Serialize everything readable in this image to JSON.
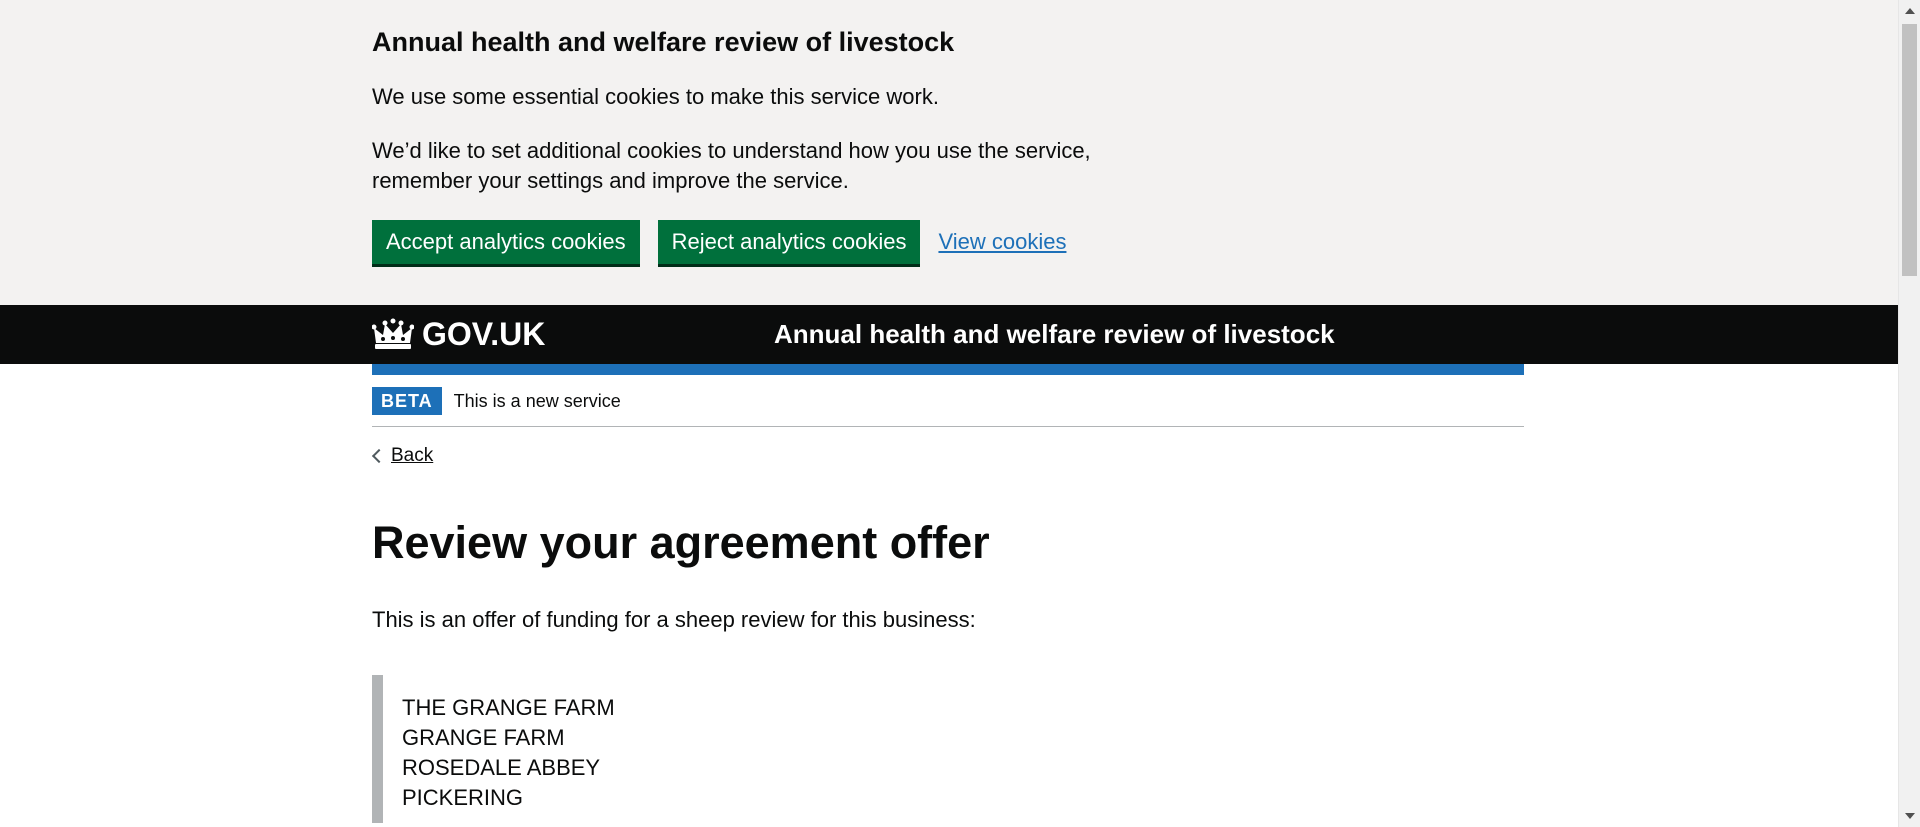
{
  "cookie_banner": {
    "heading": "Annual health and welfare review of livestock",
    "paragraph1": "We use some essential cookies to make this service work.",
    "paragraph2": "We’d like to set additional cookies to understand how you use the service, remember your settings and improve the service.",
    "accept_label": "Accept analytics cookies",
    "reject_label": "Reject analytics cookies",
    "view_label": "View cookies"
  },
  "header": {
    "logo_text": "GOV.UK",
    "logo_icon": "crown-icon",
    "service_name": "Annual health and welfare review of livestock"
  },
  "phase_banner": {
    "tag": "BETA",
    "text": "This is a new service"
  },
  "back_link": "Back",
  "main": {
    "title": "Review your agreement offer",
    "intro": "This is an offer of funding for a sheep review for this business:",
    "address_lines": [
      "THE GRANGE FARM",
      "GRANGE FARM",
      "ROSEDALE ABBEY",
      "PICKERING"
    ]
  },
  "colors": {
    "accent": "#1d70b8",
    "button": "#00703c",
    "header_bg": "#0b0c0c",
    "banner_bg": "#f3f2f1"
  }
}
